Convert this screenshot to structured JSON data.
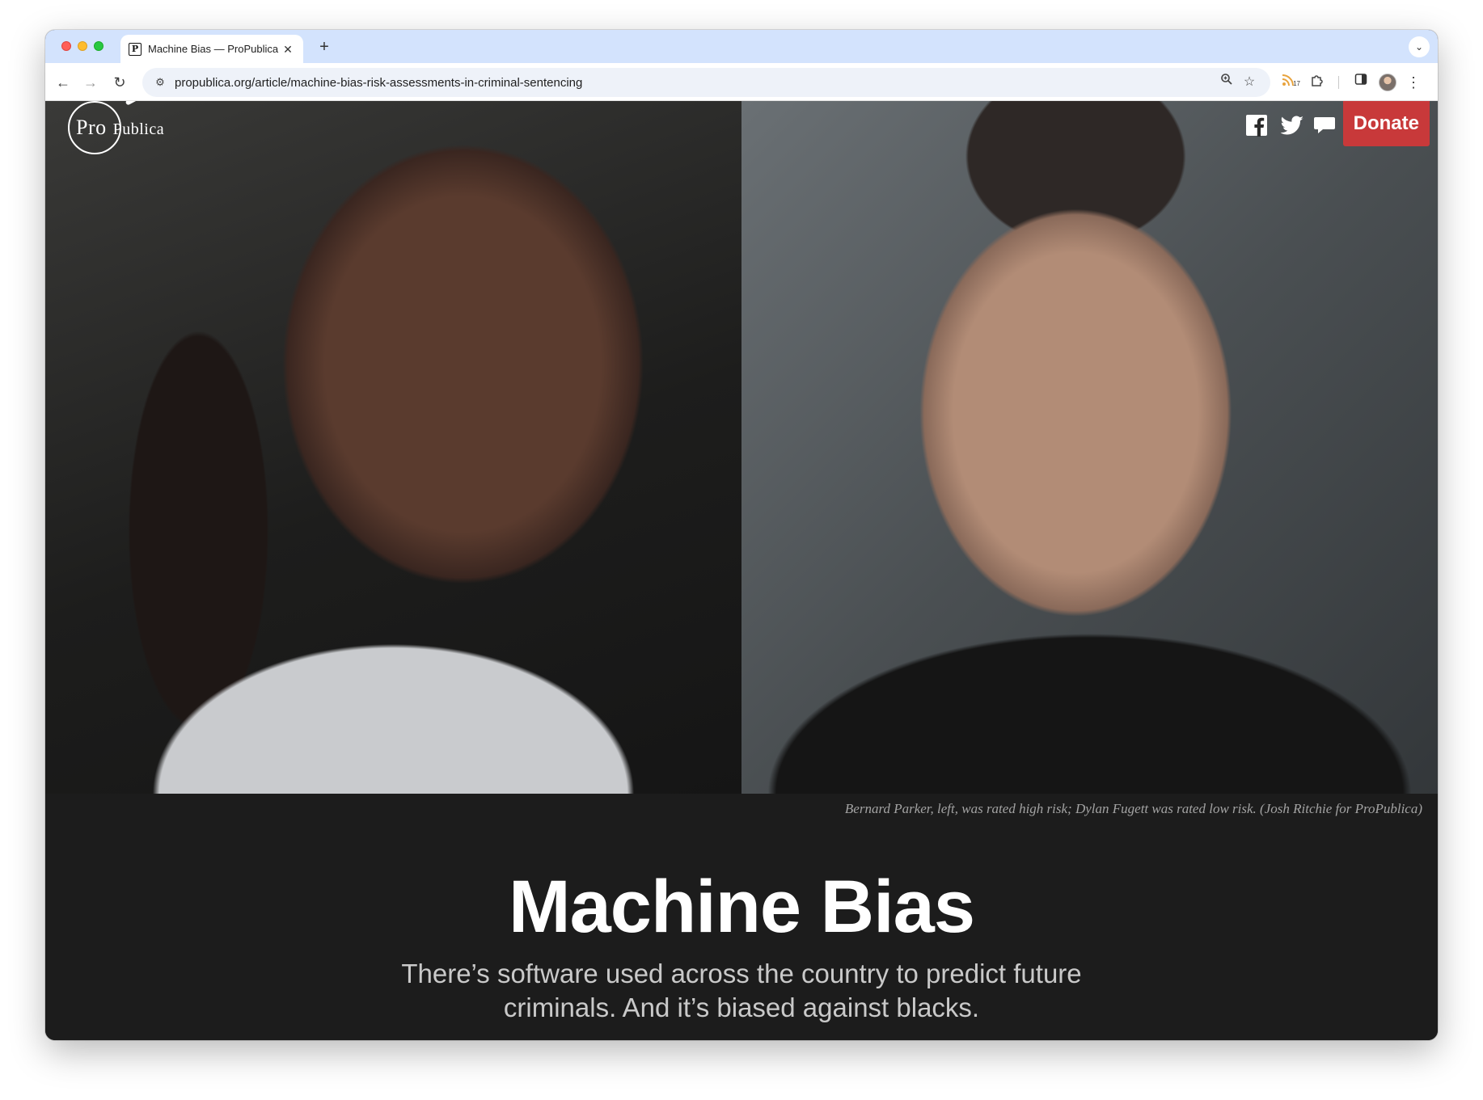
{
  "browser": {
    "tab": {
      "favicon_label": "P",
      "title": "Machine Bias — ProPublica",
      "close_glyph": "✕"
    },
    "new_tab_glyph": "+",
    "tab_search_glyph": "⌄",
    "nav": {
      "back_glyph": "←",
      "forward_glyph": "→",
      "reload_glyph": "↻"
    },
    "url": "propublica.org/article/machine-bias-risk-assessments-in-criminal-sentencing",
    "extension_badge": "17",
    "icons": [
      "site-info-icon",
      "zoom-icon",
      "bookmark-star-icon",
      "rss-extension-icon",
      "extensions-puzzle-icon",
      "side-panel-icon",
      "profile-avatar",
      "more-menu-icon"
    ]
  },
  "page": {
    "logo_text_pro": "Pro",
    "logo_text_publica": "Publica",
    "social": [
      "facebook-icon",
      "twitter-icon",
      "comment-icon"
    ],
    "donate_label": "Donate",
    "caption": "Bernard Parker, left, was rated high risk; Dylan Fugett was rated low risk. (Josh Ritchie for ProPublica)",
    "headline": "Machine Bias",
    "deck": "There’s software used across the country to predict future criminals. And it’s biased against blacks."
  },
  "colors": {
    "tabbar": "#d3e3fd",
    "page_background": "#1c1c1c",
    "donate": "#c8393a"
  }
}
